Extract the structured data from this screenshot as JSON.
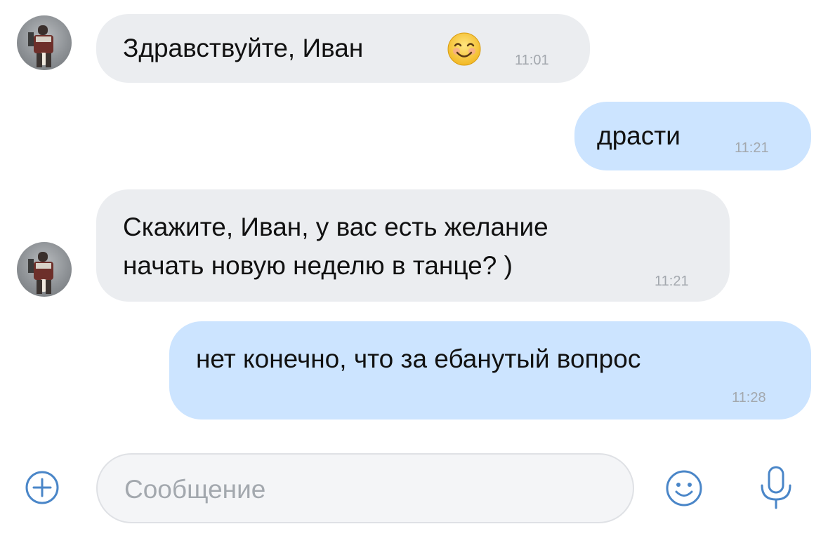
{
  "messages": [
    {
      "direction": "incoming",
      "text": "Здравствуйте, Иван",
      "emoji": "smiling-face-emoji",
      "time": "11:01"
    },
    {
      "direction": "outgoing",
      "text": "драсти",
      "time": "11:21"
    },
    {
      "direction": "incoming",
      "lines": [
        "Скажите, Иван, у вас есть желание",
        "начать новую неделю в танце? )"
      ],
      "time": "11:21"
    },
    {
      "direction": "outgoing",
      "text": "нет конечно, что за ебанутый вопрос",
      "time": "11:28"
    }
  ],
  "composer": {
    "placeholder": "Сообщение",
    "icons": [
      "plus-circle-icon",
      "smiley-icon",
      "microphone-icon"
    ]
  },
  "colors": {
    "incoming_bubble": "#ebedf0",
    "outgoing_bubble": "#cce4ff",
    "accent": "#4a86c8",
    "time_text": "#a3a8ae"
  }
}
